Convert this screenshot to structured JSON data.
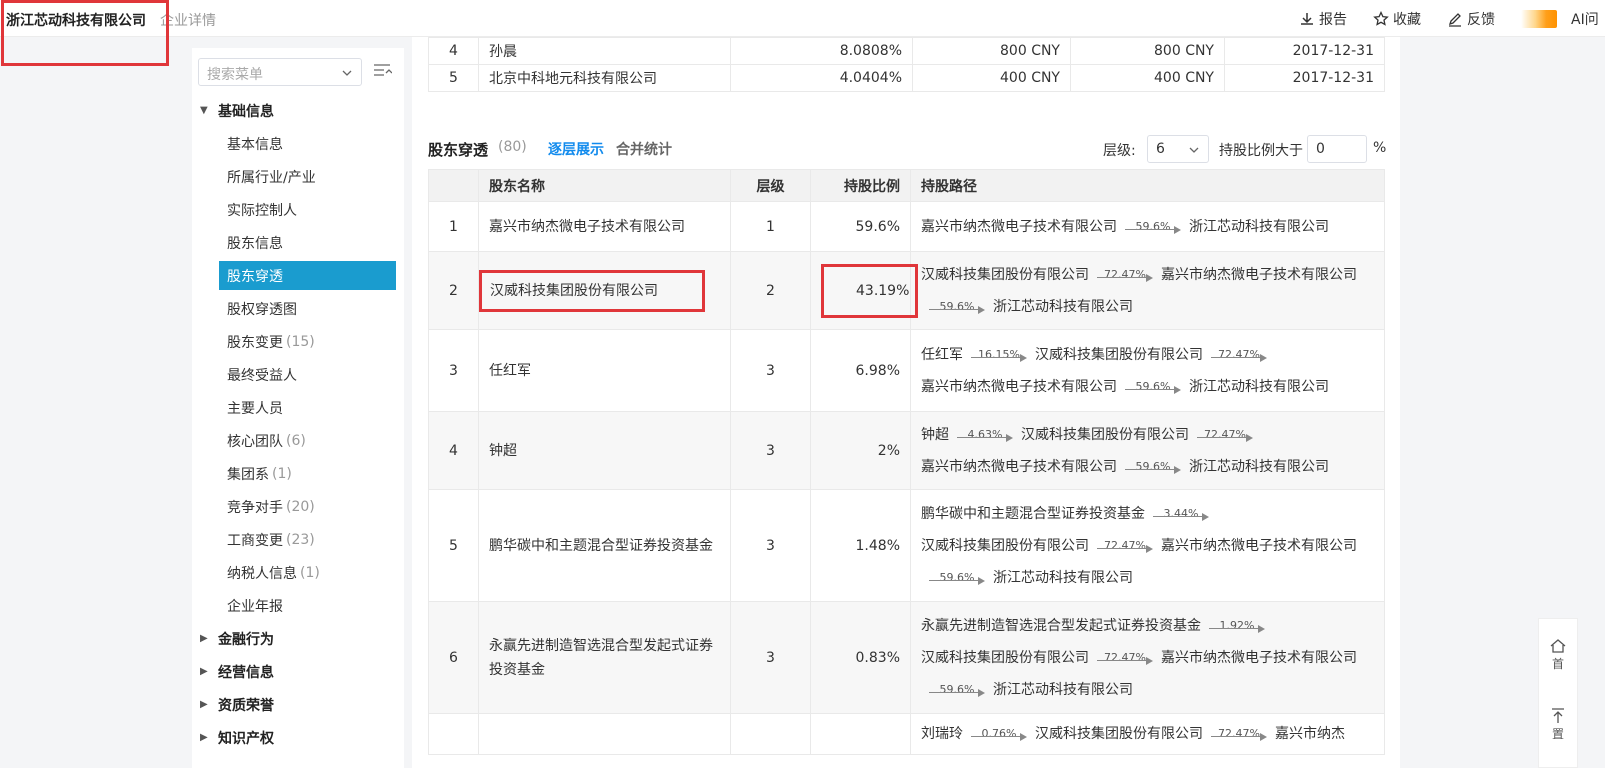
{
  "topbar": {
    "company": "浙江芯动科技有限公司",
    "subtitle": "企业详情",
    "actions": [
      {
        "label": "报告",
        "icon": "download-icon"
      },
      {
        "label": "收藏",
        "icon": "star-icon"
      },
      {
        "label": "反馈",
        "icon": "edit-icon"
      }
    ],
    "ai_label": "AI问"
  },
  "sidebar": {
    "search_placeholder": "搜索菜单",
    "groups": [
      {
        "label": "基础信息",
        "expanded": true
      },
      {
        "label": "金融行为"
      },
      {
        "label": "经营信息"
      },
      {
        "label": "资质荣誉"
      },
      {
        "label": "知识产权"
      }
    ],
    "items": [
      {
        "label": "基本信息",
        "count": ""
      },
      {
        "label": "所属行业/产业",
        "count": ""
      },
      {
        "label": "实际控制人",
        "count": ""
      },
      {
        "label": "股东信息",
        "count": ""
      },
      {
        "label": "股东穿透",
        "count": "",
        "active": true
      },
      {
        "label": "股权穿透图",
        "count": ""
      },
      {
        "label": "股东变更",
        "count": "(15)"
      },
      {
        "label": "最终受益人",
        "count": ""
      },
      {
        "label": "主要人员",
        "count": ""
      },
      {
        "label": "核心团队",
        "count": "(6)"
      },
      {
        "label": "集团系",
        "count": "(1)"
      },
      {
        "label": "竞争对手",
        "count": "(20)"
      },
      {
        "label": "工商变更",
        "count": "(23)"
      },
      {
        "label": "纳税人信息",
        "count": "(1)"
      },
      {
        "label": "企业年报",
        "count": ""
      }
    ]
  },
  "top_table": [
    {
      "idx": "4",
      "name": "孙晨",
      "ratio": "8.0808%",
      "sub": "800 CNY",
      "paid": "800 CNY",
      "date": "2017-12-31"
    },
    {
      "idx": "5",
      "name": "北京中科地元科技有限公司",
      "ratio": "4.0404%",
      "sub": "400 CNY",
      "paid": "400 CNY",
      "date": "2017-12-31"
    }
  ],
  "penetration": {
    "title": "股东穿透",
    "count": "(80)",
    "tab_layered": "逐层展示",
    "tab_merged": "合并统计",
    "level_label": "层级:",
    "level_value": "6",
    "ratio_label": "持股比例大于",
    "ratio_value": "0",
    "ratio_unit": "%",
    "headers": {
      "name": "股东名称",
      "level": "层级",
      "ratio": "持股比例",
      "path": "持股路径"
    },
    "rows": [
      {
        "idx": "1",
        "name": "嘉兴市纳杰微电子技术有限公司",
        "level": "1",
        "ratio": "59.6%",
        "path": [
          {
            "node": "嘉兴市纳杰微电子技术有限公司"
          },
          {
            "pct": "59.6%"
          },
          {
            "node": "浙江芯动科技有限公司"
          }
        ]
      },
      {
        "idx": "2",
        "name": "汉威科技集团股份有限公司",
        "level": "2",
        "ratio": "43.19%",
        "path": [
          {
            "node": "汉威科技集团股份有限公司"
          },
          {
            "pct": "72.47%"
          },
          {
            "node": "嘉兴市纳杰微电子技术有限公司"
          },
          {
            "pct": "59.6%"
          },
          {
            "node": "浙江芯动科技有限公司"
          }
        ]
      },
      {
        "idx": "3",
        "name": "任红军",
        "level": "3",
        "ratio": "6.98%",
        "path": [
          {
            "node": "任红军"
          },
          {
            "pct": "16.15%"
          },
          {
            "node": "汉威科技集团股份有限公司"
          },
          {
            "pct": "72.47%"
          },
          {
            "node": "嘉兴市纳杰微电子技术有限公司"
          },
          {
            "pct": "59.6%"
          },
          {
            "node": "浙江芯动科技有限公司"
          }
        ]
      },
      {
        "idx": "4",
        "name": "钟超",
        "level": "3",
        "ratio": "2%",
        "path": [
          {
            "node": "钟超"
          },
          {
            "pct": "4.63%"
          },
          {
            "node": "汉威科技集团股份有限公司"
          },
          {
            "pct": "72.47%"
          },
          {
            "node": "嘉兴市纳杰微电子技术有限公司"
          },
          {
            "pct": "59.6%"
          },
          {
            "node": "浙江芯动科技有限公司"
          }
        ]
      },
      {
        "idx": "5",
        "name": "鹏华碳中和主题混合型证券投资基金",
        "level": "3",
        "ratio": "1.48%",
        "path": [
          {
            "node": "鹏华碳中和主题混合型证券投资基金"
          },
          {
            "pct": "3.44%"
          },
          {
            "node": "汉威科技集团股份有限公司"
          },
          {
            "pct": "72.47%"
          },
          {
            "node": "嘉兴市纳杰微电子技术有限公司"
          },
          {
            "pct": "59.6%"
          },
          {
            "node": "浙江芯动科技有限公司"
          }
        ]
      },
      {
        "idx": "6",
        "name": "永赢先进制造智选混合型发起式证券投资基金",
        "level": "3",
        "ratio": "0.83%",
        "path": [
          {
            "node": "永赢先进制造智选混合型发起式证券投资基金"
          },
          {
            "pct": "1.92%"
          },
          {
            "node": "汉威科技集团股份有限公司"
          },
          {
            "pct": "72.47%"
          },
          {
            "node": "嘉兴市纳杰微电子技术有限公司"
          },
          {
            "pct": "59.6%"
          },
          {
            "node": "浙江芯动科技有限公司"
          }
        ]
      },
      {
        "idx": "",
        "name": "",
        "level": "",
        "ratio": "",
        "path": [
          {
            "node": "刘瑞玲"
          },
          {
            "pct": "0.76%"
          },
          {
            "node": "汉威科技集团股份有限公司"
          },
          {
            "pct": "72.47%"
          },
          {
            "node": "嘉兴市纳杰"
          }
        ]
      }
    ]
  },
  "float": {
    "home": "首",
    "top": "置"
  },
  "colors": {
    "accent": "#128bed",
    "active_menu": "#1a9ccf",
    "highlight": "#e0363a"
  }
}
